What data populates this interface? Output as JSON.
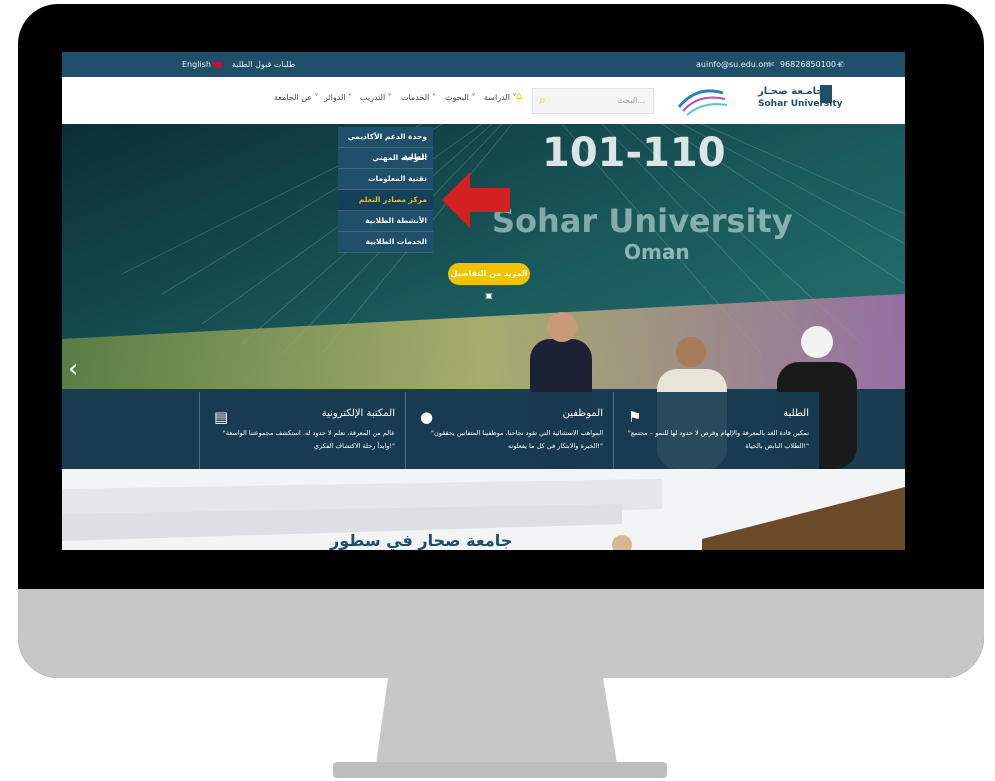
{
  "topbar": {
    "phone": "96826850100+",
    "email": "auinfo@su.edu.om",
    "admission_link": "طلبات قبول الطلبة",
    "language": "English"
  },
  "header": {
    "logo_arabic": "جامـعة صحـار",
    "logo_english": "Sohar University",
    "search_placeholder": "البحث...",
    "nav": [
      {
        "label": "الدراسة"
      },
      {
        "label": "البحوث"
      },
      {
        "label": "الخدمات"
      },
      {
        "label": "التدريب"
      },
      {
        "label": "الدوائر"
      },
      {
        "label": "عن الجامعة"
      }
    ]
  },
  "dropdown": {
    "items": [
      {
        "label": "وحدة الدعم الأكاديمي للطلبة"
      },
      {
        "label": "التوجيه المهني"
      },
      {
        "label": "تقنية المعلومات"
      },
      {
        "label": "مركز مصادر التعلم"
      },
      {
        "label": "الأنشطة الطلابية"
      },
      {
        "label": "الخدمات الطلابية"
      }
    ]
  },
  "hero": {
    "ranking": "101-110",
    "university": "Sohar University",
    "country": "Oman",
    "cta_label": "المزيد من التفاصيل"
  },
  "cards": [
    {
      "title": "الطلبة",
      "desc": "\"تمكين قادة الغد بالمعرفة والإلهام وفرص لا حدود لها للنمو – مجتمع الطلاب النابض بالحياة!\""
    },
    {
      "title": "الموظفين",
      "desc": "\"المواهب الاستثنائية التي تقود نجاحنا، موظفينا المتفانين يحققون الخبرة والابتكار في كل ما يفعلونه!\""
    },
    {
      "title": "المكتبة الإلكترونية",
      "desc": "\"عالم من المعرفة، تعلم لا حدود له. استكشف مجموعتنا الواسعة وابدأ رحلة الاكتشاف الفكري!\""
    }
  ],
  "section": {
    "heading": "جامعة صحار في سطور"
  },
  "colors": {
    "primary": "#1f4f6a",
    "accent": "#f0c200",
    "arrow": "#d32020"
  }
}
